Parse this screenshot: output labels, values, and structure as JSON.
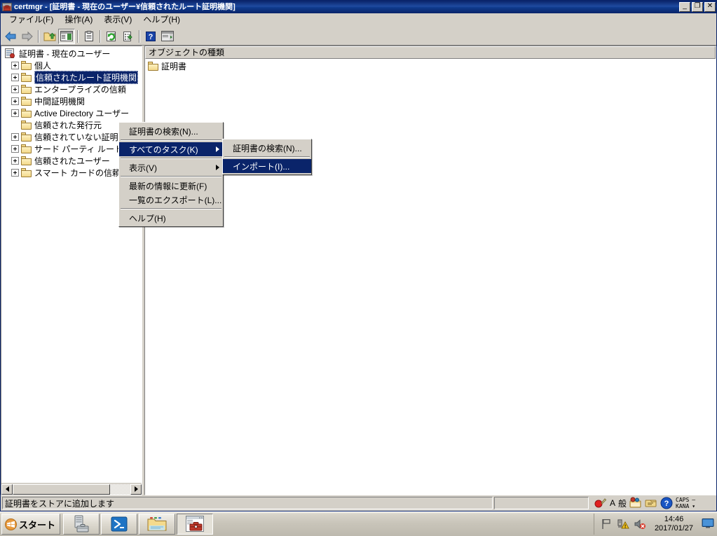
{
  "window": {
    "title": "certmgr - [証明書 - 現在のユーザー¥信頼されたルート証明機関]",
    "icon": "certmgr-icon",
    "minimize_label": "_",
    "maximize_label": "❐",
    "close_label": "✕"
  },
  "menubar": {
    "items": [
      {
        "label": "ファイル(F)",
        "name": "menu-file"
      },
      {
        "label": "操作(A)",
        "name": "menu-action"
      },
      {
        "label": "表示(V)",
        "name": "menu-view"
      },
      {
        "label": "ヘルプ(H)",
        "name": "menu-help"
      }
    ]
  },
  "toolbar": {
    "buttons": [
      {
        "name": "back-icon",
        "tooltip": "戻る"
      },
      {
        "name": "forward-icon",
        "tooltip": "進む"
      },
      {
        "name": "up-folder-icon",
        "tooltip": "上へ"
      },
      {
        "name": "show-hide-tree-icon",
        "tooltip": "コンソール ツリーの表示/非表示",
        "pressed": true
      },
      {
        "name": "properties-icon",
        "tooltip": "プロパティ"
      },
      {
        "name": "refresh-icon",
        "tooltip": "最新の情報に更新"
      },
      {
        "name": "export-list-icon",
        "tooltip": "一覧のエクスポート"
      },
      {
        "name": "help-icon",
        "tooltip": "ヘルプ"
      },
      {
        "name": "show-action-pane-icon",
        "tooltip": "操作ウィンドウの表示/非表示"
      }
    ]
  },
  "tree": {
    "root": {
      "label": "証明書 - 現在のユーザー",
      "icon": "certificate-store-icon"
    },
    "items": [
      {
        "label": "個人",
        "expandable": true,
        "selected": false
      },
      {
        "label": "信頼されたルート証明機関",
        "expandable": true,
        "selected": true
      },
      {
        "label": "エンタープライズの信頼",
        "expandable": true,
        "selected": false
      },
      {
        "label": "中間証明機関",
        "expandable": true,
        "selected": false
      },
      {
        "label": "Active Directory ユーザー",
        "expandable": true,
        "selected": false
      },
      {
        "label": "信頼された発行元",
        "expandable": false,
        "selected": false
      },
      {
        "label": "信頼されていない証明書",
        "expandable": true,
        "selected": false
      },
      {
        "label": "サード パーティ ルート証明機",
        "expandable": true,
        "selected": false
      },
      {
        "label": "信頼されたユーザー",
        "expandable": true,
        "selected": false
      },
      {
        "label": "スマート カードの信頼された",
        "expandable": true,
        "selected": false
      }
    ]
  },
  "list": {
    "columns": [
      {
        "label": "オブジェクトの種類",
        "name": "column-object-type"
      }
    ],
    "rows": [
      {
        "label": "証明書",
        "icon": "folder-icon"
      }
    ]
  },
  "context_menu": {
    "items": [
      {
        "label": "証明書の検索(N)...",
        "name": "ctx-find-certificates",
        "type": "item",
        "highlight": false,
        "submenu": false
      },
      {
        "type": "separator"
      },
      {
        "label": "すべてのタスク(K)",
        "name": "ctx-all-tasks",
        "type": "item",
        "highlight": true,
        "submenu": true
      },
      {
        "type": "separator"
      },
      {
        "label": "表示(V)",
        "name": "ctx-view",
        "type": "item",
        "highlight": false,
        "submenu": true
      },
      {
        "type": "separator"
      },
      {
        "label": "最新の情報に更新(F)",
        "name": "ctx-refresh",
        "type": "item",
        "highlight": false,
        "submenu": false
      },
      {
        "label": "一覧のエクスポート(L)...",
        "name": "ctx-export-list",
        "type": "item",
        "highlight": false,
        "submenu": false
      },
      {
        "type": "separator"
      },
      {
        "label": "ヘルプ(H)",
        "name": "ctx-help",
        "type": "item",
        "highlight": false,
        "submenu": false
      }
    ]
  },
  "context_submenu": {
    "items": [
      {
        "label": "証明書の検索(N)...",
        "name": "ctxsub-find-certificates",
        "type": "item",
        "highlight": false
      },
      {
        "type": "separator"
      },
      {
        "label": "インポート(I)...",
        "name": "ctxsub-import",
        "type": "item",
        "highlight": true
      }
    ]
  },
  "statusbar": {
    "message": "証明書をストアに追加します",
    "second_panel": "",
    "ime": {
      "mode_alpha": "A",
      "mode_kana": "般",
      "caps": "CAPS",
      "kana": "KANA"
    }
  },
  "taskbar": {
    "start_label": "スタート",
    "tasks": [
      {
        "name": "taskbar-server-manager",
        "active": false
      },
      {
        "name": "taskbar-powershell",
        "active": false
      },
      {
        "name": "taskbar-explorer",
        "active": false
      },
      {
        "name": "taskbar-certmgr",
        "active": true
      }
    ],
    "clock": {
      "time": "14:46",
      "date": "2017/01/27"
    }
  },
  "colors": {
    "title_bar": "#0a246a",
    "selection": "#0a246a",
    "window_face": "#d4d0c8",
    "desktop": "#3a6ea5",
    "folder": "#f3d98b"
  }
}
